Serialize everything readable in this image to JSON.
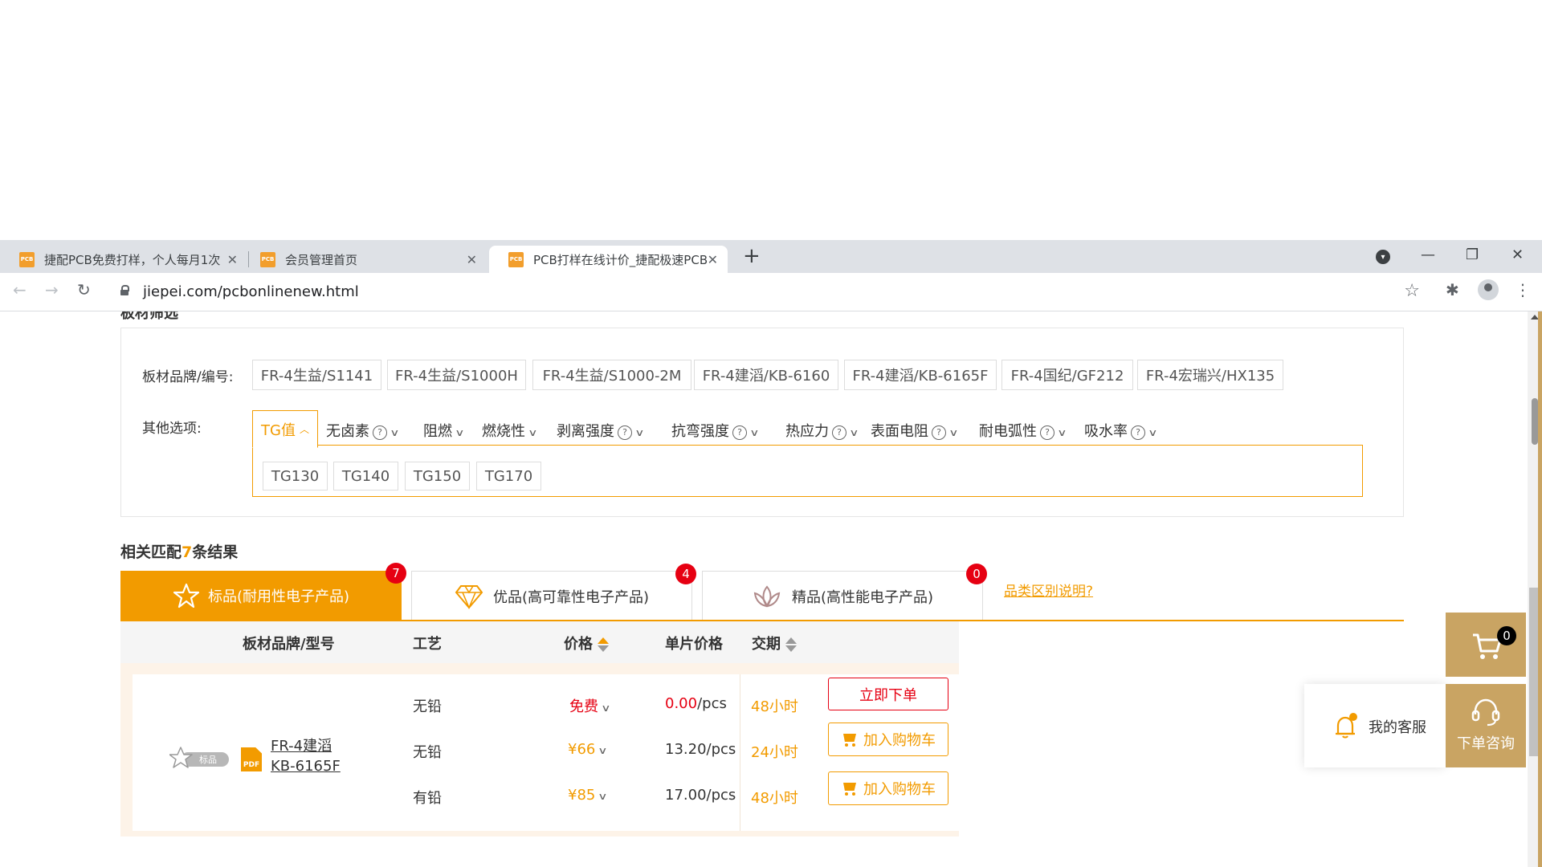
{
  "browser": {
    "tabs": [
      {
        "title": "捷配PCB免费打样，个人每月1次"
      },
      {
        "title": "会员管理首页"
      },
      {
        "title": "PCB打样在线计价_捷配极速PCB"
      }
    ],
    "new_tab": "+",
    "url": "jiepei.com/pcbonlinenew.html",
    "favicon_text": "PCB",
    "window_controls": {
      "minimize": "—",
      "maximize": "❐",
      "close": "✕"
    }
  },
  "page": {
    "cut_heading": "板材筛选",
    "filter": {
      "brand_label": "板材品牌/编号:",
      "brands": [
        "FR-4生益/S1141",
        "FR-4生益/S1000H",
        "FR-4生益/S1000-2M",
        "FR-4建滔/KB-6160",
        "FR-4建滔/KB-6165F",
        "FR-4国纪/GF212",
        "FR-4宏瑞兴/HX135"
      ],
      "other_label": "其他选项:",
      "active_option": "TG值",
      "options": [
        "无卤素",
        "阻燃",
        "燃烧性",
        "剥离强度",
        "抗弯强度",
        "热应力",
        "表面电阻",
        "耐电弧性",
        "吸水率"
      ],
      "tg_values": [
        "TG130",
        "TG140",
        "TG150",
        "TG170"
      ]
    },
    "result": {
      "prefix": "相关匹配",
      "count": "7",
      "suffix": "条结果"
    },
    "product_tabs": [
      {
        "label": "标品(耐用性电子产品)",
        "badge": "7"
      },
      {
        "label": "优品(高可靠性电子产品)",
        "badge": "4"
      },
      {
        "label": "精品(高性能电子产品)",
        "badge": "0"
      }
    ],
    "class_link": "品类区别说明?",
    "table": {
      "headers": {
        "brand": "板材品牌/型号",
        "process": "工艺",
        "price": "价格",
        "unit_price": "单片价格",
        "lead": "交期"
      },
      "std_badge": "标品",
      "pdf": "PDF",
      "model_line1": "FR-4建滔",
      "model_line2": "KB-6165F",
      "rows": [
        {
          "process": "无铅",
          "price": "免费",
          "unit_price": "0.00",
          "unit": "/pcs",
          "lead": "48小时",
          "action": "立即下单"
        },
        {
          "process": "无铅",
          "price": "¥66",
          "unit_price": "13.20/pcs",
          "lead": "24小时",
          "action": "加入购物车"
        },
        {
          "process": "有铅",
          "price": "¥85",
          "unit_price": "17.00/pcs",
          "lead": "48小时",
          "action": "加入购物车"
        }
      ]
    },
    "float": {
      "cart_count": "0",
      "service": "我的客服",
      "consult": "下单咨询"
    }
  },
  "colors": {
    "accent": "#f29b00",
    "red": "#e60012",
    "gold": "#c9a463"
  }
}
